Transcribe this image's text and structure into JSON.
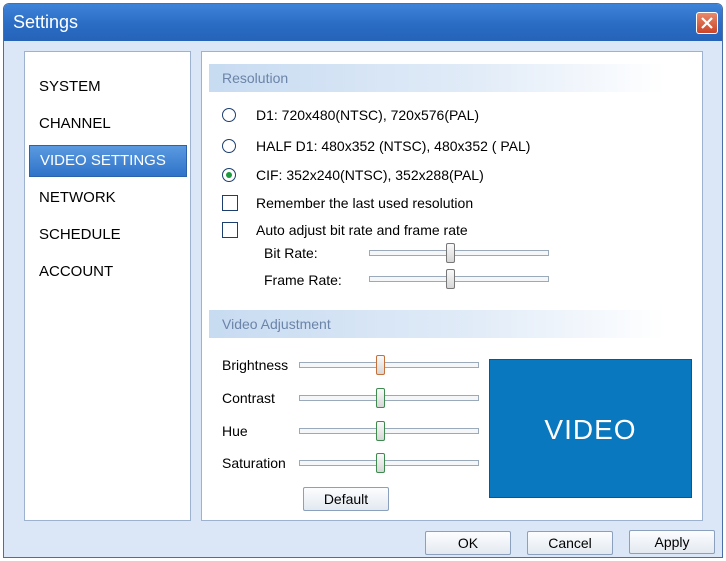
{
  "window": {
    "title": "Settings"
  },
  "sidebar": {
    "items": [
      {
        "label": "SYSTEM"
      },
      {
        "label": "CHANNEL"
      },
      {
        "label": "VIDEO SETTINGS"
      },
      {
        "label": "NETWORK"
      },
      {
        "label": "SCHEDULE"
      },
      {
        "label": "ACCOUNT"
      }
    ],
    "selected": "VIDEO SETTINGS"
  },
  "resolution": {
    "header": "Resolution",
    "options": [
      {
        "label": "D1: 720x480(NTSC), 720x576(PAL)",
        "checked": false
      },
      {
        "label": "HALF D1: 480x352 (NTSC), 480x352 ( PAL)",
        "checked": false
      },
      {
        "label": "CIF: 352x240(NTSC), 352x288(PAL)",
        "checked": true
      }
    ],
    "remember_label": "Remember the last used resolution",
    "auto_adjust_label": "Auto adjust bit rate and frame rate",
    "bit_rate": {
      "label": "Bit Rate:",
      "level": 0.45
    },
    "frame_rate": {
      "label": "Frame Rate:",
      "level": 0.45
    }
  },
  "video_adjustment": {
    "header": "Video Adjustment",
    "brightness": {
      "label": "Brightness",
      "level": 0.45,
      "thumb_color": "#c4703a"
    },
    "contrast": {
      "label": "Contrast",
      "level": 0.45,
      "thumb_color": "#3f8a4e"
    },
    "hue": {
      "label": "Hue",
      "level": 0.45,
      "thumb_color": "#3f8a4e"
    },
    "saturation": {
      "label": "Saturation",
      "level": 0.45,
      "thumb_color": "#3f8a4e"
    },
    "default_label": "Default",
    "preview_text": "VIDEO",
    "preview_color": "#0a78be"
  },
  "footer": {
    "ok_label": "OK",
    "cancel_label": "Cancel",
    "apply_label": "Apply"
  },
  "colors": {
    "titlebar": "#2a6cc4",
    "selection": "#3f7fcf",
    "close": "#c9452a"
  }
}
